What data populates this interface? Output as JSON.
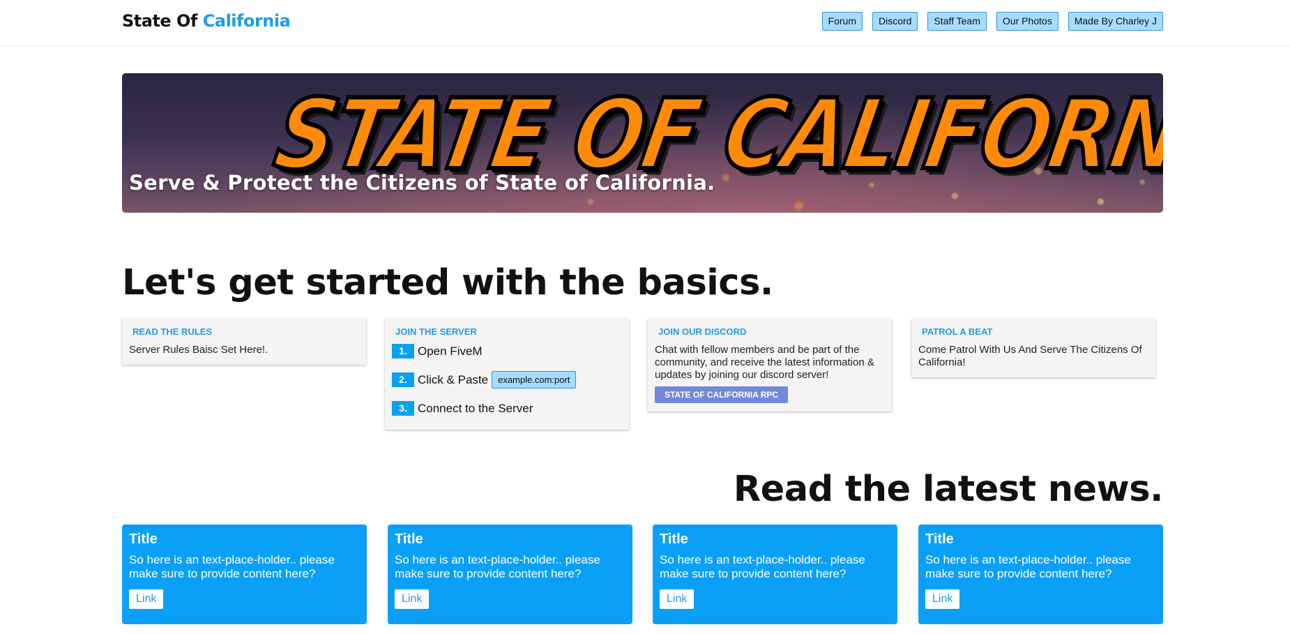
{
  "header": {
    "brand_prefix": "State Of",
    "brand_accent": "California",
    "nav": [
      "Forum",
      "Discord",
      "Staff Team",
      "Our Photos",
      "Made By Charley J"
    ]
  },
  "hero": {
    "logo_text": "STATE OF CALIFORNIA",
    "tagline": "Serve & Protect the Citizens of State of California."
  },
  "basics": {
    "heading": "Let's get started with the basics.",
    "cards": {
      "rules": {
        "title": "READ THE RULES",
        "text": "Server Rules Baisc Set Here!."
      },
      "join": {
        "title": "JOIN THE SERVER",
        "steps": [
          {
            "num": "1.",
            "text": "Open FiveM"
          },
          {
            "num": "2.",
            "text": "Click & Paste",
            "code": "example.com:port"
          },
          {
            "num": "3.",
            "text": "Connect to the Server"
          }
        ]
      },
      "discord": {
        "title": "JOIN OUR DISCORD",
        "text": "Chat with fellow members and be part of the community, and receive the latest information & updates by joining our discord server!",
        "button": "STATE OF CALIFORNIA RPC"
      },
      "patrol": {
        "title": "PATROL A BEAT",
        "text": "Come Patrol With Us And Serve The Citizens Of California!"
      }
    }
  },
  "news": {
    "heading": "Read the latest news.",
    "items": [
      {
        "title": "Title",
        "text": "So here is an text-place-holder.. please make sure to provide content here?",
        "link": "Link"
      },
      {
        "title": "Title",
        "text": "So here is an text-place-holder.. please make sure to provide content here?",
        "link": "Link"
      },
      {
        "title": "Title",
        "text": "So here is an text-place-holder.. please make sure to provide content here?",
        "link": "Link"
      },
      {
        "title": "Title",
        "text": "So here is an text-place-holder.. please make sure to provide content here?",
        "link": "Link"
      }
    ]
  },
  "colors": {
    "accent": "#1e9be8",
    "nav_bg": "#a6dcff",
    "news_bg": "#0aa0f8",
    "discord": "#7289da",
    "logo_orange": "#ff8a0a"
  }
}
